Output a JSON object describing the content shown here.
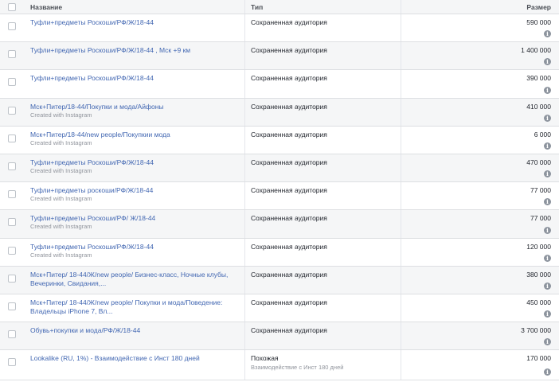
{
  "header": {
    "name": "Название",
    "type": "Тип",
    "size": "Размер"
  },
  "info_icon": "i",
  "rows": [
    {
      "name": "Туфли+предметы Роскоши/РФ/Ж/18-44",
      "sub": "",
      "type": "Сохраненная аудитория",
      "type_sub": "",
      "size": "590 000"
    },
    {
      "name": "Туфли+предметы Роскоши/РФ/Ж/18-44 , Мск +9 км",
      "sub": "",
      "type": "Сохраненная аудитория",
      "type_sub": "",
      "size": "1 400 000"
    },
    {
      "name": "Туфли+предметы Роскоши/РФ/Ж/18-44",
      "sub": "",
      "type": "Сохраненная аудитория",
      "type_sub": "",
      "size": "390 000"
    },
    {
      "name": "Мск+Питер/18-44/Покупки и мода/Айфоны",
      "sub": "Created with Instagram",
      "type": "Сохраненная аудитория",
      "type_sub": "",
      "size": "410 000"
    },
    {
      "name": "Мск+Питер/18-44/new people/Покупкии мода",
      "sub": "Created with Instagram",
      "type": "Сохраненная аудитория",
      "type_sub": "",
      "size": "6 000"
    },
    {
      "name": "Туфли+предметы Роскоши/РФ/Ж/18-44",
      "sub": "Created with Instagram",
      "type": "Сохраненная аудитория",
      "type_sub": "",
      "size": "470 000"
    },
    {
      "name": "Туфли+предметы роскоши/РФ/Ж/18-44",
      "sub": "Created with Instagram",
      "type": "Сохраненная аудитория",
      "type_sub": "",
      "size": "77 000"
    },
    {
      "name": "Туфли+предметы Роскоши/РФ/ Ж/18-44",
      "sub": "Created with Instagram",
      "type": "Сохраненная аудитория",
      "type_sub": "",
      "size": "77 000"
    },
    {
      "name": "Туфли+предметы Роскоши/РФ/Ж/18-44",
      "sub": "Created with Instagram",
      "type": "Сохраненная аудитория",
      "type_sub": "",
      "size": "120 000"
    },
    {
      "name": "Мск+Питер/ 18-44/Ж/new people/ Бизнес-класс, Ночные клубы, Вечеринки, Свидания,...",
      "sub": "",
      "type": "Сохраненная аудитория",
      "type_sub": "",
      "size": "380 000"
    },
    {
      "name": "Мск+Питер/ 18-44/Ж/new people/ Покупки и мода/Поведение: Владельцы iPhone 7, Вл...",
      "sub": "",
      "type": "Сохраненная аудитория",
      "type_sub": "",
      "size": "450 000"
    },
    {
      "name": "Обувь+покупки и мода/РФ/Ж/18-44",
      "sub": "",
      "type": "Сохраненная аудитория",
      "type_sub": "",
      "size": "3 700 000"
    },
    {
      "name": "Lookalike (RU, 1%) - Взаимодействие с Инст 180 дней",
      "sub": "",
      "type": "Похожая",
      "type_sub": "Взаимодействие с Инст 180 дней",
      "size": "170 000"
    }
  ]
}
